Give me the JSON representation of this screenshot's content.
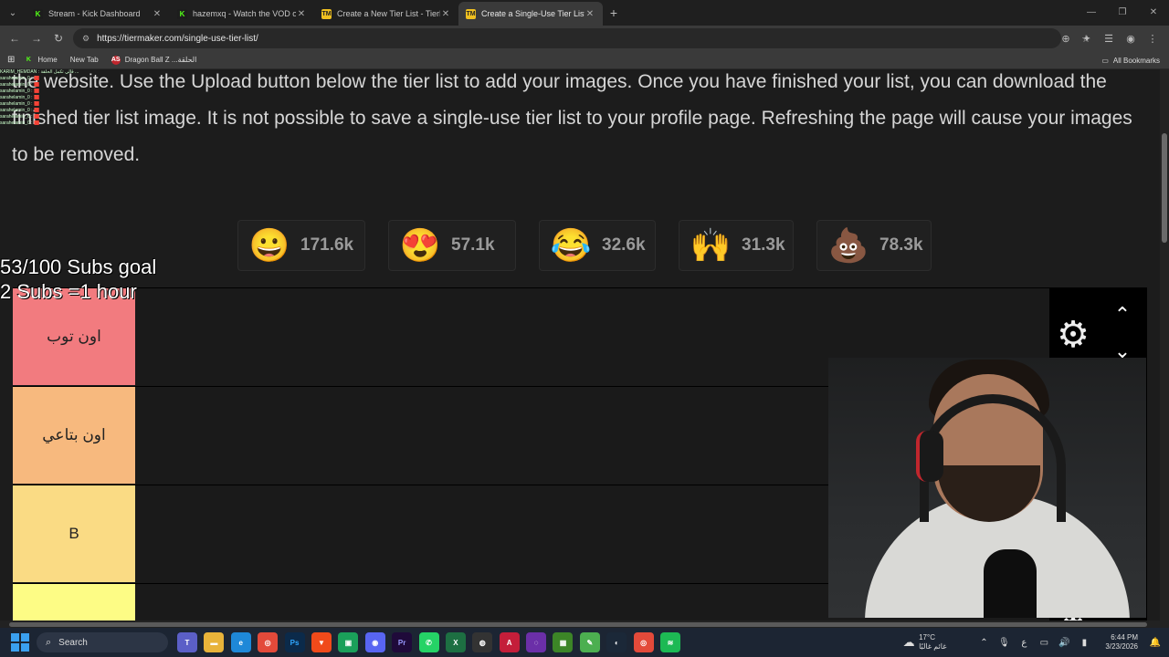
{
  "tabs": [
    {
      "label": "Stream - Kick Dashboard",
      "fav": "K",
      "kind": "kick"
    },
    {
      "label": "hazemxq - Watch the VOD on K",
      "fav": "K",
      "kind": "kick"
    },
    {
      "label": "Create a New Tier List - TierMak",
      "fav": "TM",
      "kind": "tm"
    },
    {
      "label": "Create a Single-Use Tier List (Pr",
      "fav": "TM",
      "kind": "tm",
      "active": true
    }
  ],
  "address": {
    "url": "https://tiermaker.com/single-use-tier-list/"
  },
  "bookmarks": [
    {
      "label": "Home",
      "icon": "kick-icon"
    },
    {
      "label": "New Tab",
      "icon": ""
    },
    {
      "label": "Dragon Ball Z ...الحلقة",
      "icon": "AS"
    }
  ],
  "bookmarks_all": "All Bookmarks",
  "intro_text": "the website. Use the Upload button below the tier list to add your images. Once you have finished your list, you can download the finished tier list image. It is not possible to save a single-use tier list to your profile page. Refreshing the page will cause your images to be removed.",
  "reactions": [
    {
      "emoji": "😀",
      "count": "171.6k"
    },
    {
      "emoji": "😍",
      "count": "57.1k"
    },
    {
      "emoji": "😂",
      "count": "32.6k"
    },
    {
      "emoji": "🙌",
      "count": "31.3k"
    },
    {
      "emoji": "💩",
      "count": "78.3k"
    }
  ],
  "tiers": [
    {
      "label": "اون توب",
      "color": "#f27b7f"
    },
    {
      "label": "اون بتاعي",
      "color": "#f7b97e"
    },
    {
      "label": "B",
      "color": "#fadb84"
    },
    {
      "label": "",
      "color": "#fdfc85"
    }
  ],
  "overlay": {
    "goal_line1": "53/100 Subs goal",
    "goal_line2": "2 Subs =1 hour"
  },
  "chat_lines": [
    "KARIM_HEMDAN : قالي تكمل الحلقة ...",
    "sarahelamin_0 : 🟥",
    "sarahelamin_0 : 🟥",
    "sarahelamin_0 : 🟥",
    "sarahelamin_0 : 🟥",
    "sarahelamin_0 : 🟥",
    "sarahelamin_0 : 🟥",
    "sarahelamin_0 : 🟥",
    "sarahelamin_0 : 🟥"
  ],
  "taskbar": {
    "search_label": "Search",
    "weather_temp": "17°C",
    "weather_desc": "غائم غالبًا",
    "lang": "ع",
    "time": "6:44 PM",
    "date": "3/23/2026"
  }
}
